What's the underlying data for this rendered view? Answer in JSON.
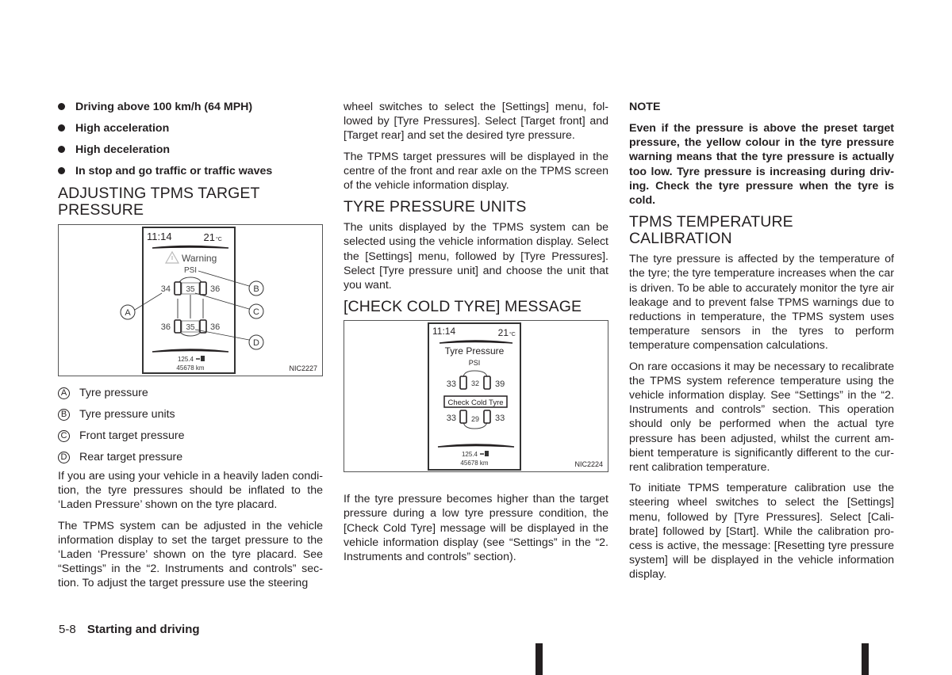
{
  "col1": {
    "bullets": [
      "Driving above 100 km/h (64 MPH)",
      "High acceleration",
      "High deceleration",
      "In stop and go traffic or traffic waves"
    ],
    "heading_adjusting": "ADJUSTING TPMS TARGET PRESSURE",
    "figure1": {
      "code": "NIC2227",
      "time": "11:14",
      "temp": "21",
      "temp_unit": "°C",
      "warning_label": "Warning",
      "unit": "PSI",
      "front_left": "34",
      "front_target": "35",
      "front_right": "36",
      "rear_left": "36",
      "rear_target": "35",
      "rear_right": "36",
      "range": "125.4",
      "odometer": "45678 km",
      "callouts": [
        "A",
        "B",
        "C",
        "D"
      ]
    },
    "legend": [
      {
        "letter": "A",
        "text": "Tyre pressure"
      },
      {
        "letter": "B",
        "text": "Tyre pressure units"
      },
      {
        "letter": "C",
        "text": "Front target pressure"
      },
      {
        "letter": "D",
        "text": "Rear target pressure"
      }
    ],
    "para_laden": "If you are using your vehicle in a heavily laden condi­tion, the tyre pressures should be inflated to the ‘Laden Pressure’ shown on the tyre placard.",
    "para_adjust": "The TPMS system can be adjusted in the vehicle information display to set the target pressure to the ‘Laden ‘Pressure’ shown on the tyre placard. See “Settings” in the “2. Instruments and controls” sec­tion. To adjust the target pressure use the steering"
  },
  "col2": {
    "para_cont": "wheel switches to select the [Settings] menu, fol­lowed by [Tyre Pressures]. Select [Target front] and [Target rear] and set the desired tyre pressure.",
    "para_display": "The TPMS target pressures will be displayed in the centre of the front and rear axle on the TPMS screen of the vehicle information display.",
    "heading_units": "TYRE PRESSURE UNITS",
    "para_units": "The units displayed by the TPMS system can be selected using the vehicle information display. Se­lect the [Settings] menu, followed by [Tyre Pres­sures]. Select [Tyre pressure unit] and choose the unit that you want.",
    "heading_cold": "[CHECK COLD TYRE] MESSAGE",
    "figure2": {
      "code": "NIC2224",
      "time": "11:14",
      "temp": "21",
      "temp_unit": "°C",
      "title": "Tyre Pressure",
      "unit": "PSI",
      "front_left": "33",
      "front_target": "32",
      "front_right": "39",
      "message": "Check Cold Tyre",
      "rear_left": "33",
      "rear_target": "29",
      "rear_right": "33",
      "range": "125.4",
      "odometer": "45678 km"
    },
    "para_cold": "If the tyre pressure becomes higher than the target pressure during a low tyre pressure condition, the [Check Cold Tyre] message will be displayed in the vehicle information display (see “Settings” in the “2. Instruments and controls” section)."
  },
  "col3": {
    "note_title": "NOTE",
    "note_text": "Even if the pressure is above the preset target pressure, the yellow colour in the tyre pressure warning means that the tyre pressure is actually too low. Tyre pressure is increasing during driv­ing. Check the tyre pressure when the tyre is cold.",
    "heading_calib": "TPMS TEMPERATURE CALIBRATION",
    "para_temp": "The tyre pressure is affected by the temperature of the tyre; the tyre temperature increases when the car is driven. To be able to accurately monitor the tyre air leakage and to prevent false TPMS warnings due to reductions in temperature, the TPMS system uses temperature sensors in the tyres to perform temperature compensation calculations.",
    "para_rare": "On rare occasions it may be necessary to recalibrate the TPMS system reference temperature using the vehicle information display. See “Settings” in the “2. Instruments and controls” section. This opera­tion should only be performed when the actual tyre pressure has been adjusted, whilst the current am­bient temperature is significantly different to the cur­rent calibration temperature.",
    "para_initiate": "To initiate TPMS temperature calibration use the steering wheel switches to select the [Settings] menu, followed by [Tyre Pressures]. Select [Cali­brate] followed by [Start]. While the calibration pro­cess is active, the message: [Resetting tyre pres­sure system] will be displayed in the vehicle informa­tion display."
  },
  "footer": {
    "page_number": "5-8",
    "section_title": "Starting and driving"
  }
}
